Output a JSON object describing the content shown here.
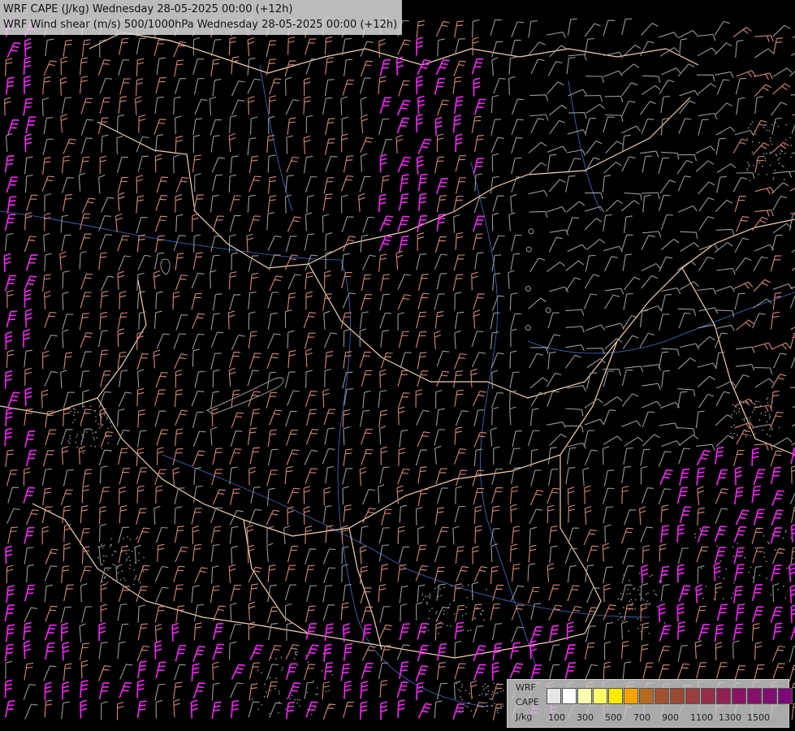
{
  "header": {
    "line1": "WRF CAPE (J/kg) Wednesday 28-05-2025 00:00 (+12h)",
    "line2": "WRF Wind shear (m/s) 500/1000hPa Wednesday 28-05-2025 00:00 (+12h)"
  },
  "legend": {
    "label_model": "WRF",
    "label_field": "CAPE",
    "label_units": "J/kg",
    "colors": [
      "#e6e6e6",
      "#ffffff",
      "#ffffb0",
      "#ffff66",
      "#ffea00",
      "#f5a300",
      "#b56a1f",
      "#a0522d",
      "#9c4a33",
      "#9a3d3d",
      "#962e48",
      "#901f52",
      "#8a1260",
      "#85106b",
      "#800e70",
      "#7b0a78"
    ],
    "ticks": [
      "100",
      "300",
      "500",
      "700",
      "900",
      "1100",
      "1300",
      "1500"
    ]
  },
  "map": {
    "background": "#000000",
    "border_color": "#f2d2b0",
    "river_color": "#4a6fc7",
    "lake_color": "#bbbbbb",
    "barb_colors": {
      "weak": "#9a9a9a",
      "moderate": "#d98a7a",
      "strong": "#e0307f",
      "extreme": "#ff22ff"
    }
  }
}
